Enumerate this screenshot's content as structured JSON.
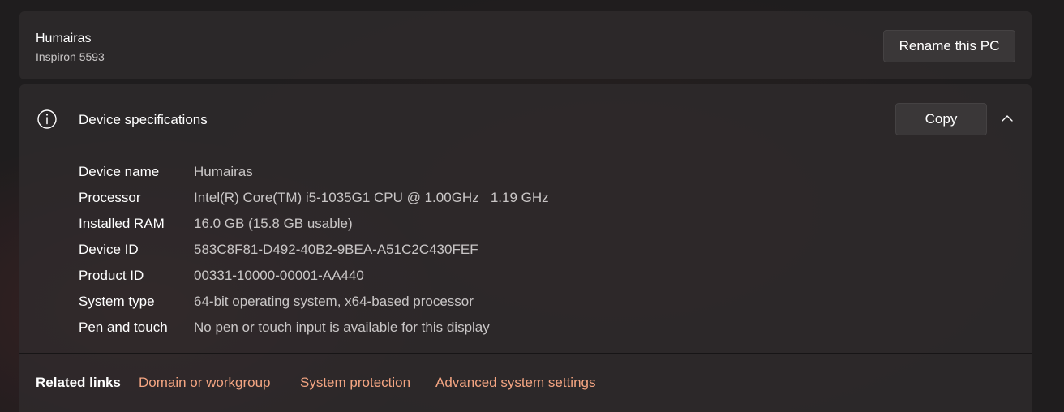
{
  "pc": {
    "name": "Humairas",
    "model": "Inspiron 5593",
    "rename_label": "Rename this PC"
  },
  "specs": {
    "icon": "info-icon",
    "title": "Device specifications",
    "copy_label": "Copy",
    "expanded": true,
    "rows": [
      {
        "label": "Device name",
        "value": "Humairas"
      },
      {
        "label": "Processor",
        "value": "Intel(R) Core(TM) i5-1035G1 CPU @ 1.00GHz   1.19 GHz"
      },
      {
        "label": "Installed RAM",
        "value": "16.0 GB (15.8 GB usable)"
      },
      {
        "label": "Device ID",
        "value": "583C8F81-D492-40B2-9BEA-A51C2C430FEF"
      },
      {
        "label": "Product ID",
        "value": "00331-10000-00001-AA440"
      },
      {
        "label": "System type",
        "value": "64-bit operating system, x64-based processor"
      },
      {
        "label": "Pen and touch",
        "value": "No pen or touch input is available for this display"
      }
    ]
  },
  "related": {
    "label": "Related links",
    "links": [
      {
        "label": "Domain or workgroup"
      },
      {
        "label": "System protection"
      },
      {
        "label": "Advanced system settings"
      }
    ]
  },
  "colors": {
    "background": "#1f1d1e",
    "card": "#302c2d",
    "link_accent": "#f4a582",
    "secondary_text": "#c9c6c6"
  }
}
